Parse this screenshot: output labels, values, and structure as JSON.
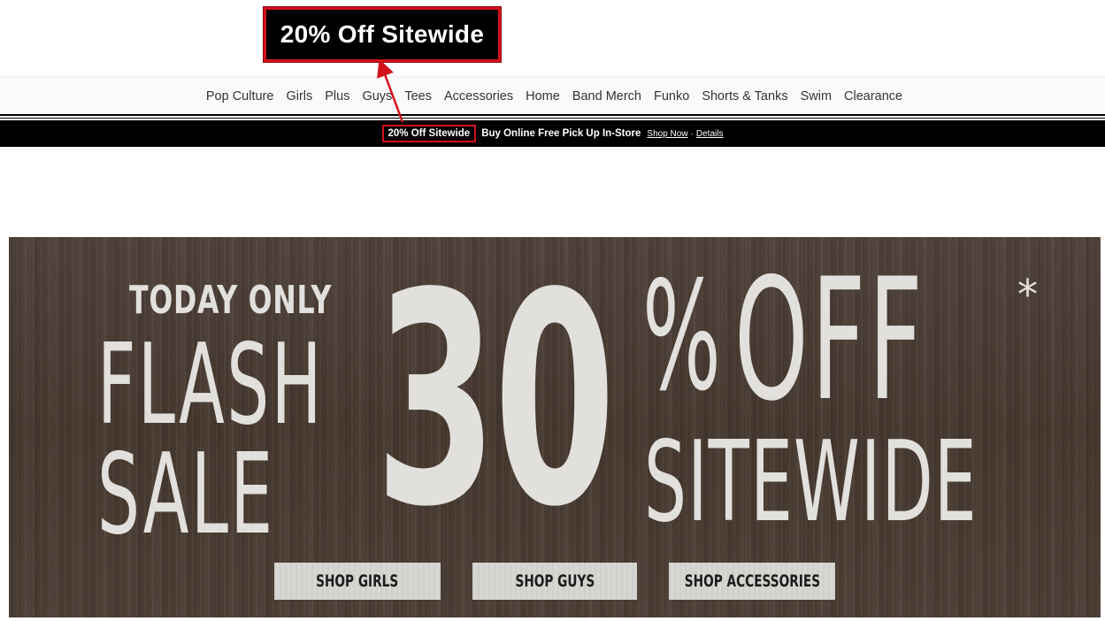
{
  "callout": {
    "text": "20% Off Sitewide"
  },
  "nav": {
    "items": [
      "Pop Culture",
      "Girls",
      "Plus",
      "Guys",
      "Tees",
      "Accessories",
      "Home",
      "Band Merch",
      "Funko",
      "Shorts & Tanks",
      "Swim",
      "Clearance"
    ]
  },
  "promo": {
    "highlight": "20% Off Sitewide",
    "main": "Buy Online Free Pick Up In-Store",
    "shop_now": "Shop Now",
    "separator": "·",
    "details": "Details"
  },
  "hero": {
    "today_only": "TODAY ONLY",
    "flash": "FLASH",
    "sale": "SALE",
    "thirty": "30",
    "percent": "%",
    "off": "OFF",
    "asterisk": "*",
    "sitewide": "SITEWIDE",
    "buttons": {
      "girls": "SHOP GIRLS",
      "guys": "SHOP GUYS",
      "accessories": "SHOP ACCESSORIES"
    }
  },
  "colors": {
    "annotation_red": "#d4111b",
    "promo_bar": "#000000",
    "hero_background": "#4a3d35",
    "hero_text": "#e2e0dc"
  }
}
